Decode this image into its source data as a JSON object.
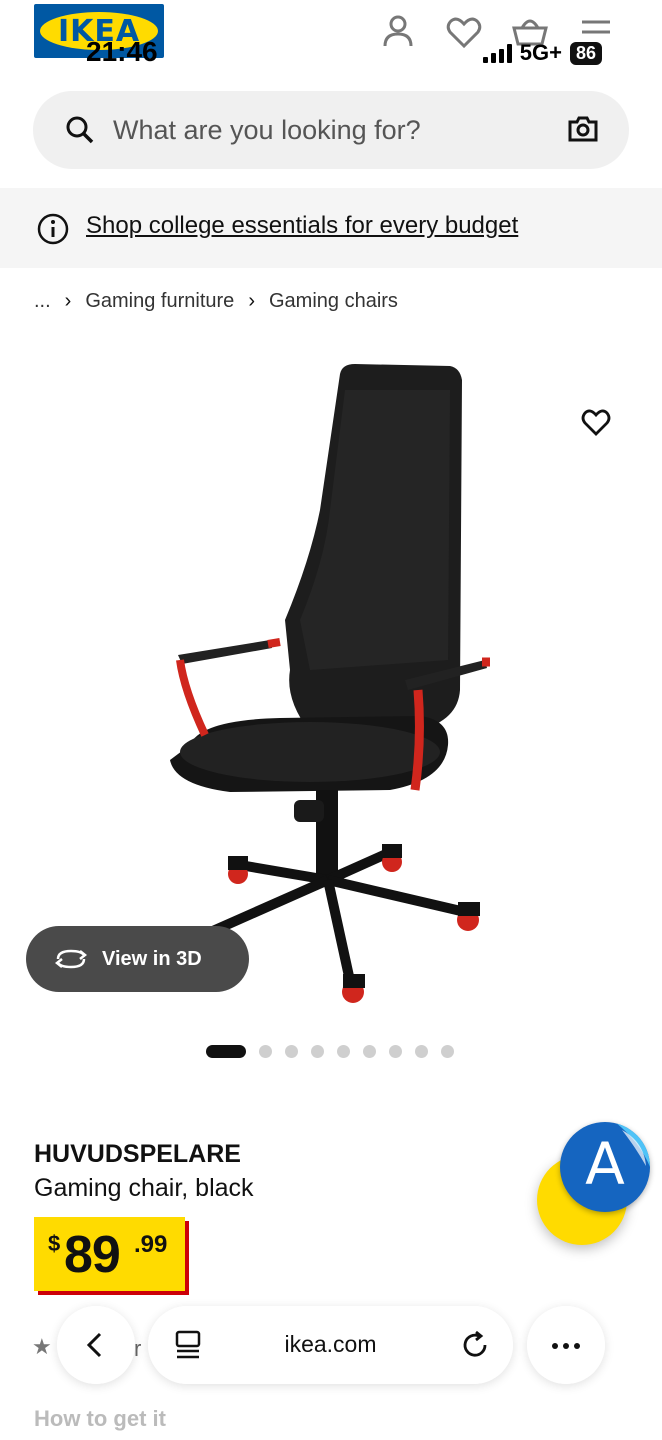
{
  "status": {
    "time": "21:46",
    "network": "5G+",
    "battery": "86"
  },
  "header": {
    "logo": "IKEA",
    "icons": [
      "person-icon",
      "heart-icon",
      "basket-icon",
      "menu-icon"
    ]
  },
  "search": {
    "placeholder": "What are you looking for?"
  },
  "banner": {
    "text": "Shop college essentials for every budget"
  },
  "breadcrumb": {
    "ellipsis": "...",
    "items": [
      "Gaming furniture",
      "Gaming chairs"
    ]
  },
  "gallery": {
    "view3d_label": "View in 3D",
    "dot_count": 9,
    "active_index": 0
  },
  "product": {
    "name": "HUVUDSPELARE",
    "description": "Gaming chair, black",
    "price": {
      "currency": "$",
      "whole": "89",
      "cents": ".99"
    }
  },
  "translate": {
    "letter": "A"
  },
  "partial": {
    "rating_fragment": "r",
    "how_to_get": "How to get it"
  },
  "browser": {
    "url": "ikea.com"
  },
  "colors": {
    "ikea_blue": "#0058a3",
    "ikea_yellow": "#ffdb00",
    "price_red": "#cc0008",
    "chair_red": "#d0261d"
  }
}
